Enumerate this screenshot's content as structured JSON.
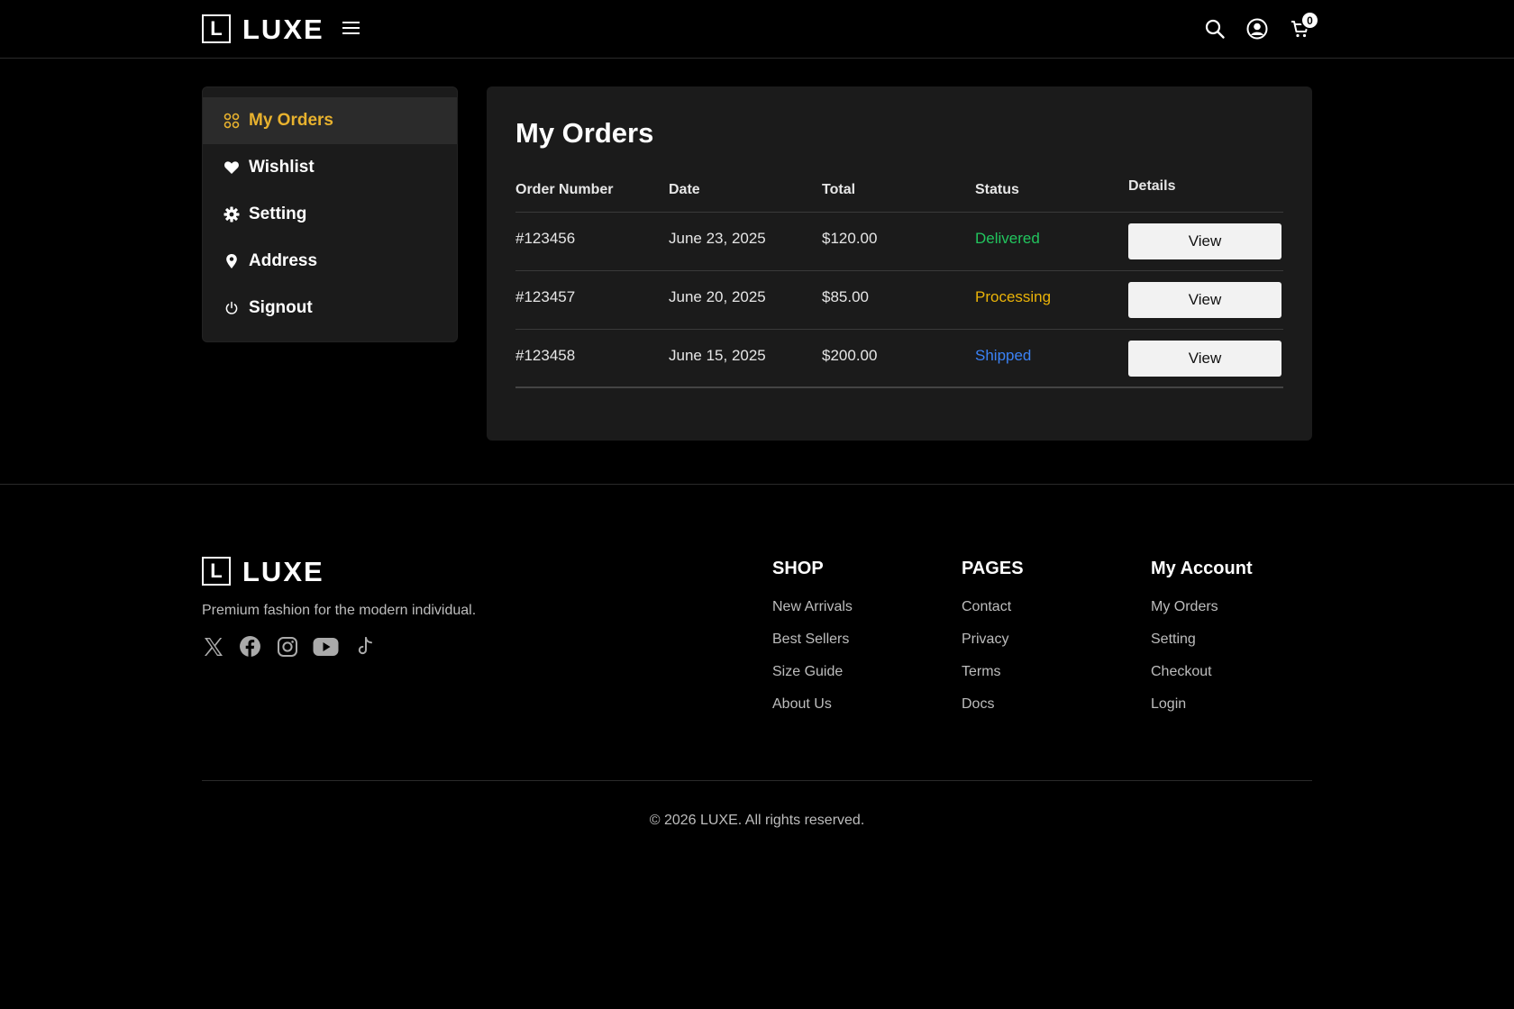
{
  "header": {
    "logo_letter": "L",
    "logo_text": "LUXE",
    "cart_count": "0",
    "icons": [
      "menu-icon",
      "search-icon",
      "user-icon",
      "cart-icon"
    ]
  },
  "sidebar": {
    "items": [
      {
        "label": "My Orders",
        "icon": "grid-icon",
        "active": true
      },
      {
        "label": "Wishlist",
        "icon": "heart-icon"
      },
      {
        "label": "Setting",
        "icon": "gear-icon"
      },
      {
        "label": "Address",
        "icon": "location-pin-icon"
      },
      {
        "label": "Signout",
        "icon": "power-icon"
      }
    ]
  },
  "orders": {
    "title": "My Orders",
    "columns": [
      "Order Number",
      "Date",
      "Total",
      "Status",
      "Details"
    ],
    "rows": [
      {
        "number": "#123456",
        "date": "June 23, 2025",
        "total": "$120.00",
        "status": "Delivered",
        "action": "View"
      },
      {
        "number": "#123457",
        "date": "June 20, 2025",
        "total": "$85.00",
        "status": "Processing",
        "action": "View"
      },
      {
        "number": "#123458",
        "date": "June 15, 2025",
        "total": "$200.00",
        "status": "Shipped",
        "action": "View"
      }
    ]
  },
  "colors": {
    "accent": "#e8b22e",
    "delivered": "#22c55e",
    "processing": "#eab308",
    "shipped": "#3b82f6"
  },
  "footer": {
    "logo_letter": "L",
    "logo_text": "LUXE",
    "tagline": "Premium fashion for the modern individual.",
    "socials": [
      "x-icon",
      "facebook-icon",
      "instagram-icon",
      "youtube-icon",
      "tiktok-icon"
    ],
    "shop": {
      "title": "SHOP",
      "links": [
        "New Arrivals",
        "Best Sellers",
        "Size Guide",
        "About Us"
      ]
    },
    "pages": {
      "title": "PAGES",
      "links": [
        "Contact",
        "Privacy",
        "Terms",
        "Docs"
      ]
    },
    "account": {
      "title": "My Account",
      "links": [
        "My Orders",
        "Setting",
        "Checkout",
        "Login"
      ]
    },
    "copyright": "© 2026 LUXE. All rights reserved."
  }
}
